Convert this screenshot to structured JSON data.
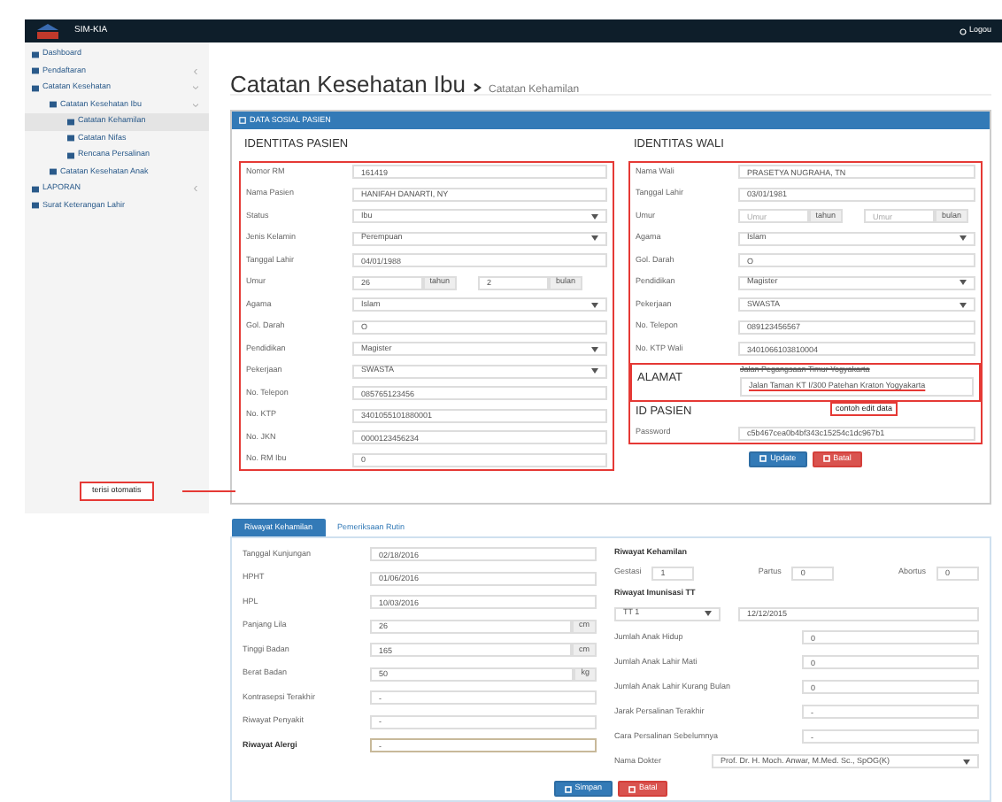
{
  "header": {
    "brand": "SIM-KIA",
    "logout": "Logou"
  },
  "sidebar": {
    "items": [
      {
        "label": "Dashboard",
        "selected": false
      },
      {
        "label": "Pendaftaran",
        "selected": false,
        "expanded": false
      },
      {
        "label": "Catatan Kesehatan",
        "selected": false,
        "expanded": true,
        "children": [
          {
            "label": "Catatan Kesehatan Ibu",
            "selected": false,
            "expanded": true,
            "children": [
              {
                "label": "Catatan Kehamilan",
                "selected": true
              },
              {
                "label": "Catatan Nifas",
                "selected": false
              },
              {
                "label": "Rencana Persalinan",
                "selected": false
              }
            ]
          },
          {
            "label": "Catatan Kesehatan Anak",
            "selected": false
          }
        ]
      },
      {
        "label": "LAPORAN",
        "selected": false,
        "expanded": false
      },
      {
        "label": "Surat Keterangan Lahir",
        "selected": false
      }
    ]
  },
  "page_title": "Catatan Kesehatan Ibu",
  "breadcrumb": "Catatan Kehamilan",
  "panel": {
    "title": "DATA SOSIAL PASIEN",
    "patient": {
      "heading": "IDENTITAS PASIEN",
      "fields": [
        {
          "label": "Nomor RM",
          "kind": "text",
          "value": "161419"
        },
        {
          "label": "Nama Pasien",
          "kind": "text",
          "value": "HANIFAH DANARTI, NY"
        },
        {
          "label": "Status",
          "kind": "select",
          "value": "Ibu"
        },
        {
          "label": "Jenis Kelamin",
          "kind": "select",
          "value": "Perempuan"
        },
        {
          "label": "Tanggal Lahir",
          "kind": "text",
          "value": "04/01/1988"
        },
        {
          "label": "Umur",
          "kind": "age",
          "parts": [
            {
              "value": "26",
              "unit": "tahun"
            },
            {
              "value": "2",
              "unit": "bulan"
            }
          ]
        },
        {
          "label": "Agama",
          "kind": "select",
          "value": "Islam"
        },
        {
          "label": "Gol. Darah",
          "kind": "text",
          "value": "O"
        },
        {
          "label": "Pendidikan",
          "kind": "select",
          "value": "Magister"
        },
        {
          "label": "Pekerjaan",
          "kind": "select",
          "value": "SWASTA"
        },
        {
          "label": "No. Telepon",
          "kind": "text",
          "value": "085765123456"
        },
        {
          "label": "No. KTP",
          "kind": "text",
          "value": "3401055101880001"
        },
        {
          "label": "No. JKN",
          "kind": "text",
          "value": "0000123456234"
        },
        {
          "label": "No. RM Ibu",
          "kind": "text",
          "value": "0"
        }
      ]
    },
    "guardian": {
      "heading": "IDENTITAS WALI",
      "fields": [
        {
          "label": "Nama Wali",
          "kind": "text",
          "value": "PRASETYA NUGRAHA, TN"
        },
        {
          "label": "Tanggal Lahir",
          "kind": "text",
          "value": "03/01/1981"
        },
        {
          "label": "Umur",
          "kind": "age",
          "parts": [
            {
              "placeholder": "Umur",
              "unit": "tahun"
            },
            {
              "placeholder": "Umur",
              "unit": "bulan"
            }
          ]
        },
        {
          "label": "Agama",
          "kind": "select",
          "value": "Islam"
        },
        {
          "label": "Gol. Darah",
          "kind": "text",
          "value": "O"
        },
        {
          "label": "Pendidikan",
          "kind": "select",
          "value": "Magister"
        },
        {
          "label": "Pekerjaan",
          "kind": "select",
          "value": "SWASTA"
        },
        {
          "label": "No. Telepon",
          "kind": "text",
          "value": "089123456567"
        },
        {
          "label": "No. KTP Wali",
          "kind": "text",
          "value": "3401066103810004"
        }
      ],
      "address": {
        "label": "ALAMAT",
        "old_value": "Jalan Pegangsaan Timur Yogyakarta",
        "value": "Jalan Taman KT I/300 Patehan Kraton Yogyakarta"
      },
      "id_heading": "ID PASIEN",
      "password": {
        "label": "Password",
        "value": "c5b467cea0b4bf343c15254c1dc967b1"
      }
    },
    "buttons": [
      {
        "label": "Update",
        "kind": "primary"
      },
      {
        "label": "Batal",
        "kind": "danger"
      }
    ]
  },
  "annotations": [
    {
      "text": "terisi otomatis"
    },
    {
      "text": "contoh edit data"
    }
  ],
  "tabs": [
    {
      "label": "Riwayat Kehamilan",
      "selected": true
    },
    {
      "label": "Pemeriksaan Rutin",
      "selected": false
    }
  ],
  "history": {
    "left_fields": [
      {
        "label": "Tanggal Kunjungan",
        "value": "02/18/2016"
      },
      {
        "label": "HPHT",
        "value": "01/06/2016"
      },
      {
        "label": "HPL",
        "value": "10/03/2016"
      },
      {
        "label": "Panjang Lila",
        "value": "26",
        "unit": "cm"
      },
      {
        "label": "Tinggi Badan",
        "value": "165",
        "unit": "cm"
      },
      {
        "label": "Berat Badan",
        "value": "50",
        "unit": "kg"
      },
      {
        "label": "Kontrasepsi Terakhir",
        "value": "-"
      },
      {
        "label": "Riwayat Penyakit",
        "value": "-"
      },
      {
        "label": "Riwayat Alergi",
        "value": "-",
        "focused": true
      }
    ],
    "pregnancy_heading": "Riwayat Kehamilan",
    "pregnancy": [
      {
        "label": "Gestasi",
        "value": "1"
      },
      {
        "label": "Partus",
        "value": "0"
      },
      {
        "label": "Abortus",
        "value": "0"
      }
    ],
    "immunization_heading": "Riwayat Imunisasi TT",
    "immunization": {
      "dose": "TT 1",
      "date": "12/12/2015"
    },
    "right_fields": [
      {
        "label": "Jumlah Anak Hidup",
        "kind": "text",
        "value": "0"
      },
      {
        "label": "Jumlah Anak Lahir Mati",
        "kind": "text",
        "value": "0"
      },
      {
        "label": "Jumlah Anak Lahir Kurang Bulan",
        "kind": "text",
        "value": "0"
      },
      {
        "label": "Jarak Persalinan Terakhir",
        "kind": "text",
        "value": "-"
      },
      {
        "label": "Cara Persalinan Sebelumnya",
        "kind": "text",
        "value": "-"
      },
      {
        "label": "Nama Dokter",
        "kind": "select",
        "value": "Prof. Dr. H. Moch. Anwar, M.Med. Sc., SpOG(K)"
      }
    ],
    "buttons": [
      {
        "label": "Simpan",
        "kind": "primary"
      },
      {
        "label": "Batal",
        "kind": "danger"
      }
    ]
  }
}
